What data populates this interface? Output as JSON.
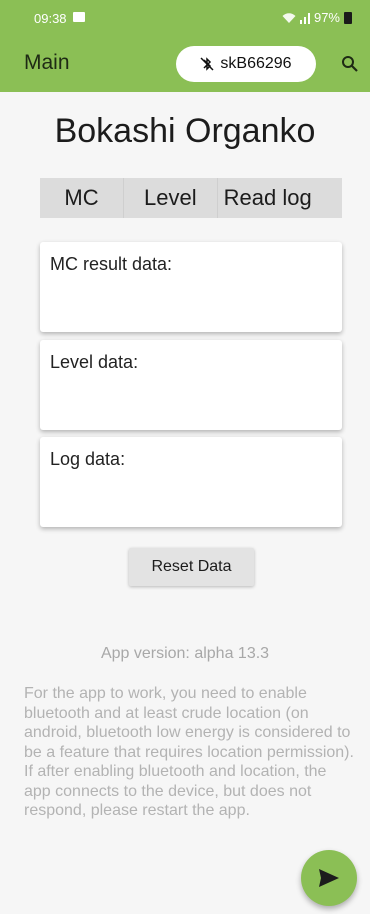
{
  "status_bar": {
    "time": "09:38",
    "battery": "97%",
    "icons": [
      "image-icon",
      "wifi-icon",
      "signal-icon",
      "battery-icon"
    ]
  },
  "app_bar": {
    "title": "Main",
    "device_chip": {
      "icon": "bluetooth-disabled-icon",
      "label": "skB66296"
    },
    "search_icon": "search-icon"
  },
  "main": {
    "heading": "Bokashi Organko",
    "tabs": [
      {
        "label": "MC"
      },
      {
        "label": "Level"
      },
      {
        "label": "Read log"
      }
    ],
    "cards": [
      {
        "label": "MC result data:"
      },
      {
        "label": "Level data:"
      },
      {
        "label": "Log data:"
      }
    ],
    "reset_button": "Reset Data",
    "version": "App version: alpha 13.3",
    "help_text": "For the app to work, you need to enable bluetooth and at least crude location (on android, bluetooth low energy is considered to be a feature that requires location permission). If after enabling bluetooth and location, the app connects to the device, but does not respond, please restart the app."
  },
  "fab": {
    "icon": "send-icon"
  },
  "colors": {
    "accent": "#8bbf55",
    "card_bg": "#ffffff",
    "muted_text": "#b3b3b3"
  }
}
